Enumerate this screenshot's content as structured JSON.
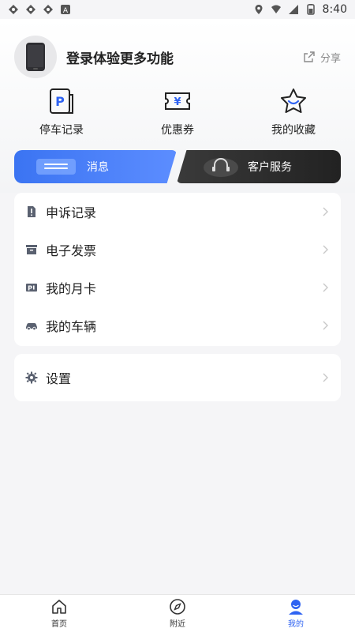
{
  "status": {
    "time": "8:40"
  },
  "profile": {
    "login_text": "登录体验更多功能",
    "share_label": "分享"
  },
  "quick": [
    {
      "label": "停车记录",
      "icon": "parking-record-icon"
    },
    {
      "label": "优惠券",
      "icon": "coupon-icon"
    },
    {
      "label": "我的收藏",
      "icon": "favorite-icon"
    }
  ],
  "tabs": {
    "messages": "消息",
    "service": "客户服务"
  },
  "menu": [
    {
      "label": "申诉记录",
      "icon": "complaint-icon"
    },
    {
      "label": "电子发票",
      "icon": "invoice-icon"
    },
    {
      "label": "我的月卡",
      "icon": "monthly-card-icon"
    },
    {
      "label": "我的车辆",
      "icon": "vehicle-icon"
    }
  ],
  "settings": {
    "label": "设置",
    "icon": "gear-icon"
  },
  "nav": [
    {
      "label": "首页",
      "icon": "home-icon"
    },
    {
      "label": "附近",
      "icon": "compass-icon"
    },
    {
      "label": "我的",
      "icon": "user-icon",
      "active": true
    }
  ],
  "colors": {
    "accent": "#2f63f2",
    "tab_blue": "#3b74f2",
    "tab_dark": "#2b2b2b"
  }
}
